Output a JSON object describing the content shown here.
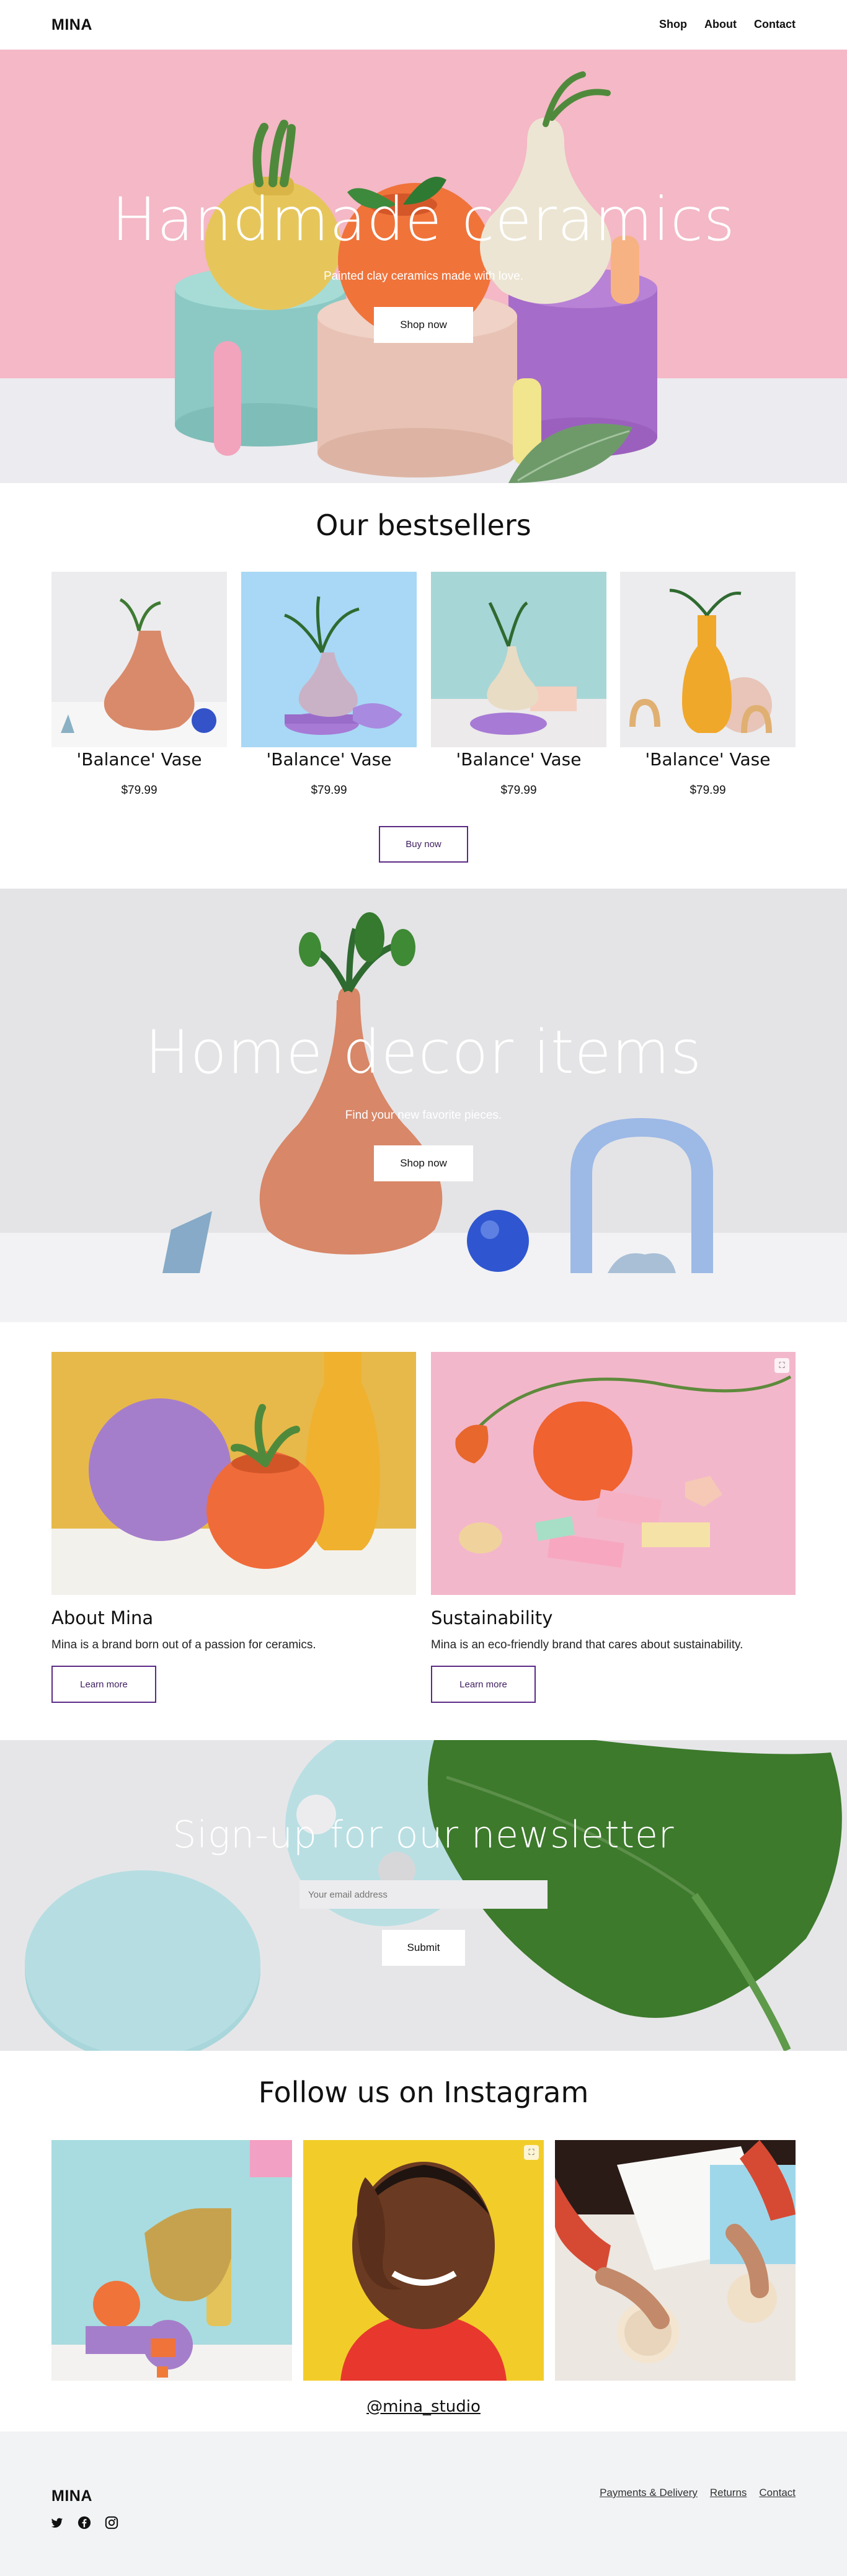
{
  "header": {
    "brand": "MINA",
    "nav": [
      "Shop",
      "About",
      "Contact"
    ]
  },
  "hero": {
    "title": "Handmade ceramics",
    "subtitle": "Painted clay ceramics made with love.",
    "button": "Shop now"
  },
  "bestsellers": {
    "title": "Our bestsellers",
    "products": [
      {
        "name": "'Balance' Vase",
        "price": "$79.99"
      },
      {
        "name": "'Balance' Vase",
        "price": "$79.99"
      },
      {
        "name": "'Balance' Vase",
        "price": "$79.99"
      },
      {
        "name": "'Balance' Vase",
        "price": "$79.99"
      }
    ],
    "button": "Buy now"
  },
  "decor": {
    "title": "Home decor items",
    "subtitle": "Find your new favorite pieces.",
    "button": "Shop now"
  },
  "cards": [
    {
      "title": "About Mina",
      "text": "Mina is a brand born out of a passion for ceramics.",
      "button": "Learn more"
    },
    {
      "title": "Sustainability",
      "text": "Mina is an eco-friendly brand that cares about sustainability.",
      "button": "Learn more"
    }
  ],
  "newsletter": {
    "title": "Sign-up for our newsletter",
    "placeholder": "Your email address",
    "button": "Submit"
  },
  "instagram": {
    "title": "Follow us on Instagram",
    "handle": "@mina_studio"
  },
  "footer": {
    "brand": "MINA",
    "links": [
      "Payments & Delivery",
      "Returns",
      "Contact"
    ],
    "social_icons": [
      "twitter-icon",
      "facebook-icon",
      "instagram-icon"
    ]
  },
  "colors": {
    "hero_pink": "#f4b8c6",
    "accent_purple": "#5b2a86",
    "footer_bg": "#f2f3f5"
  }
}
